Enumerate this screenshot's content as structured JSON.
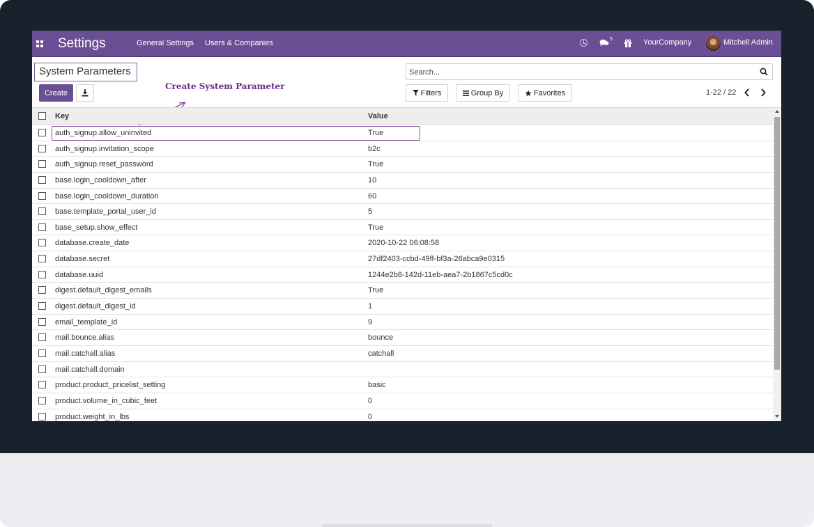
{
  "navbar": {
    "app_title": "Settings",
    "menu": [
      "General Settings",
      "Users & Companies"
    ],
    "chat_badge": "5",
    "company": "YourCompany",
    "user": "Mitchell Admin",
    "icons": [
      "apps-grid-icon",
      "activity-clock-icon",
      "chat-icon",
      "gift-icon"
    ]
  },
  "control_panel": {
    "breadcrumb_title": "System Parameters",
    "create_label": "Create",
    "search_placeholder": "Search...",
    "filters_label": "Filters",
    "group_by_label": "Group By",
    "favorites_label": "Favorites",
    "pager": "1-22 / 22"
  },
  "annotation": {
    "text": "Create  System  Parameter",
    "color": "#6b2a88"
  },
  "list": {
    "headers": {
      "key": "Key",
      "value": "Value"
    },
    "rows": [
      {
        "key": "auth_signup.allow_uninvited",
        "value": "True"
      },
      {
        "key": "auth_signup.invitation_scope",
        "value": "b2c"
      },
      {
        "key": "auth_signup.reset_password",
        "value": "True"
      },
      {
        "key": "base.login_cooldown_after",
        "value": "10"
      },
      {
        "key": "base.login_cooldown_duration",
        "value": "60"
      },
      {
        "key": "base.template_portal_user_id",
        "value": "5"
      },
      {
        "key": "base_setup.show_effect",
        "value": "True"
      },
      {
        "key": "database.create_date",
        "value": "2020-10-22 06:08:58"
      },
      {
        "key": "database.secret",
        "value": "27df2403-ccbd-49ff-bf3a-26abca9e0315"
      },
      {
        "key": "database.uuid",
        "value": "1244e2b8-142d-11eb-aea7-2b1867c5cd0c"
      },
      {
        "key": "digest.default_digest_emails",
        "value": "True"
      },
      {
        "key": "digest.default_digest_id",
        "value": "1"
      },
      {
        "key": "email_template_id",
        "value": "9"
      },
      {
        "key": "mail.bounce.alias",
        "value": "bounce"
      },
      {
        "key": "mail.catchall.alias",
        "value": "catchall"
      },
      {
        "key": "mail.catchall.domain",
        "value": ""
      },
      {
        "key": "product.product_pricelist_setting",
        "value": "basic"
      },
      {
        "key": "product.volume_in_cubic_feet",
        "value": "0"
      },
      {
        "key": "product.weight_in_lbs",
        "value": "0"
      }
    ]
  },
  "colors": {
    "brand": "#6b4f95",
    "bezel": "#18222d"
  }
}
